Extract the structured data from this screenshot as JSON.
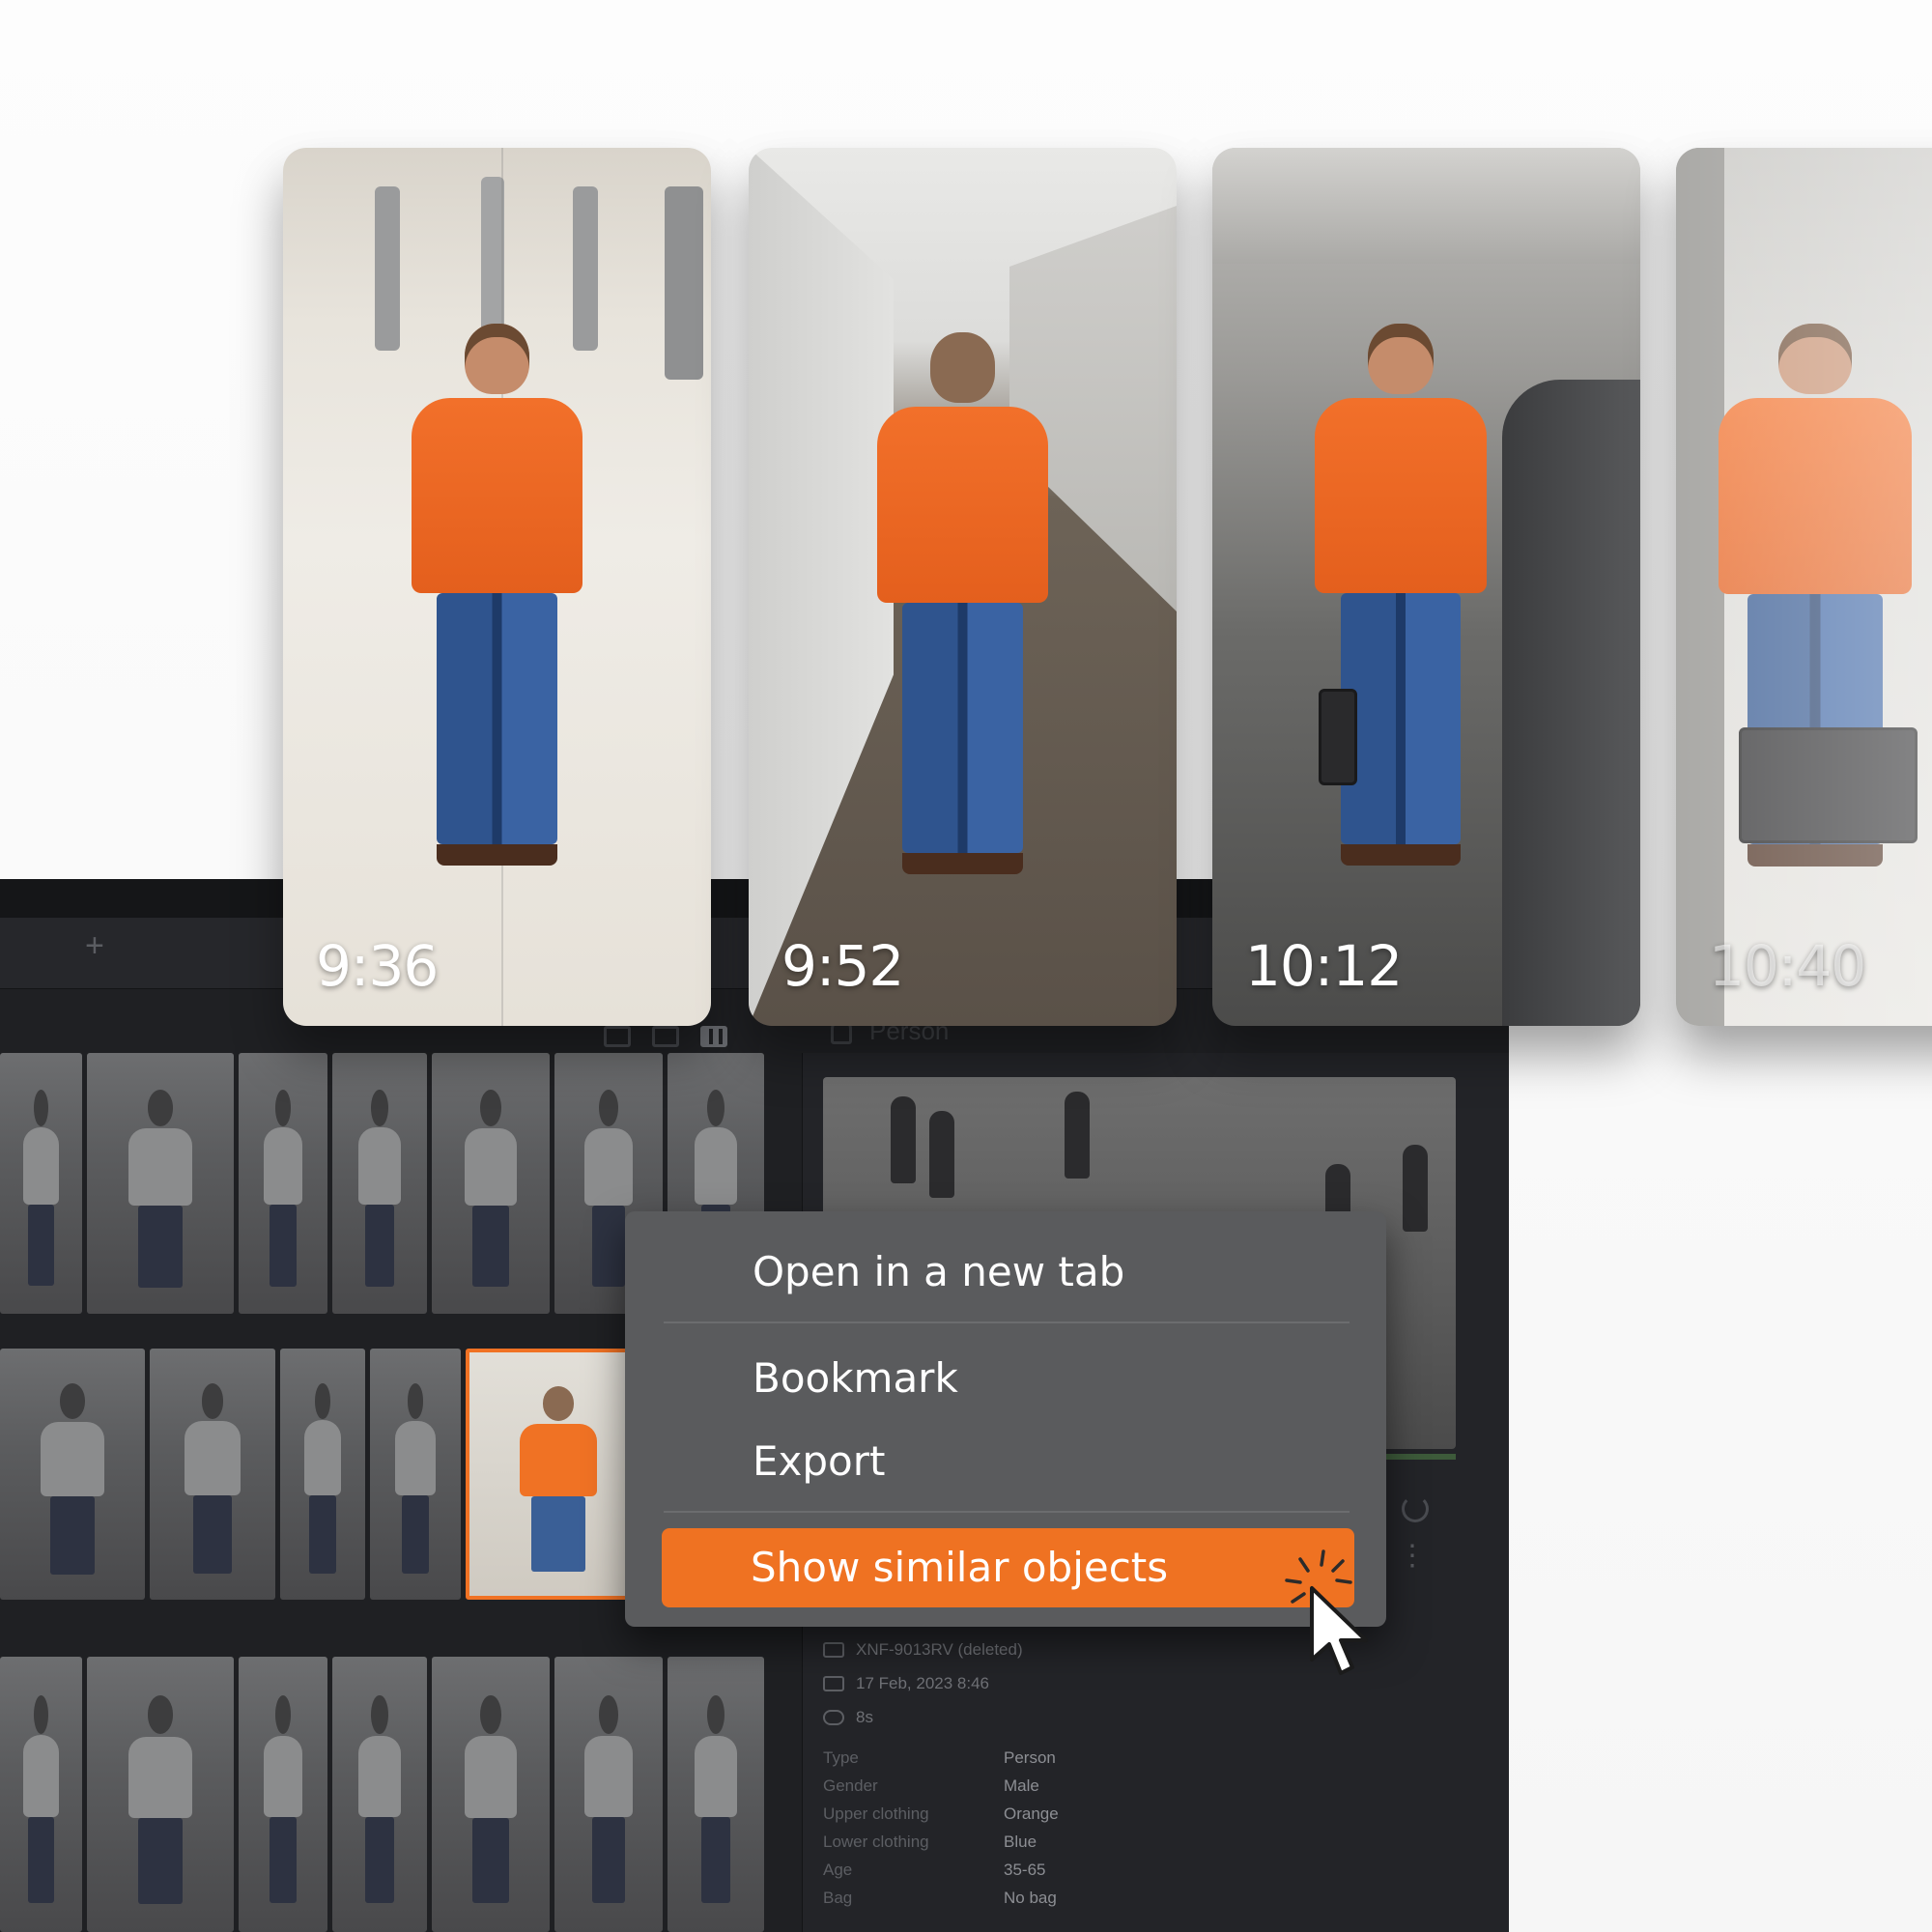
{
  "app": {
    "add_tab_glyph": "+",
    "detail_object_type": "Person",
    "camera": "XNF-9013RV (deleted)",
    "date": "17 Feb, 2023 8:46",
    "duration": "8s",
    "attributes": [
      {
        "key": "Type",
        "value": "Person"
      },
      {
        "key": "Gender",
        "value": "Male"
      },
      {
        "key": "Upper clothing",
        "value": "Orange"
      },
      {
        "key": "Lower clothing",
        "value": "Blue"
      },
      {
        "key": "Age",
        "value": "35-65"
      },
      {
        "key": "Bag",
        "value": "No bag"
      }
    ]
  },
  "timeline": [
    {
      "time": "9:36"
    },
    {
      "time": "9:52"
    },
    {
      "time": "10:12"
    },
    {
      "time": "10:40"
    }
  ],
  "context_menu": {
    "open_new_tab": "Open in a new tab",
    "bookmark": "Bookmark",
    "export": "Export",
    "show_similar": "Show similar objects"
  },
  "colors": {
    "accent": "#ef7222",
    "panel": "#1f2023",
    "menu": "#5a5b5d"
  },
  "icons": [
    "person-icon",
    "camera-icon",
    "calendar-icon",
    "duration-icon",
    "refresh-icon",
    "more-vertical-icon",
    "list-view-icon",
    "grid-view-icon",
    "column-view-icon",
    "cursor-icon"
  ]
}
